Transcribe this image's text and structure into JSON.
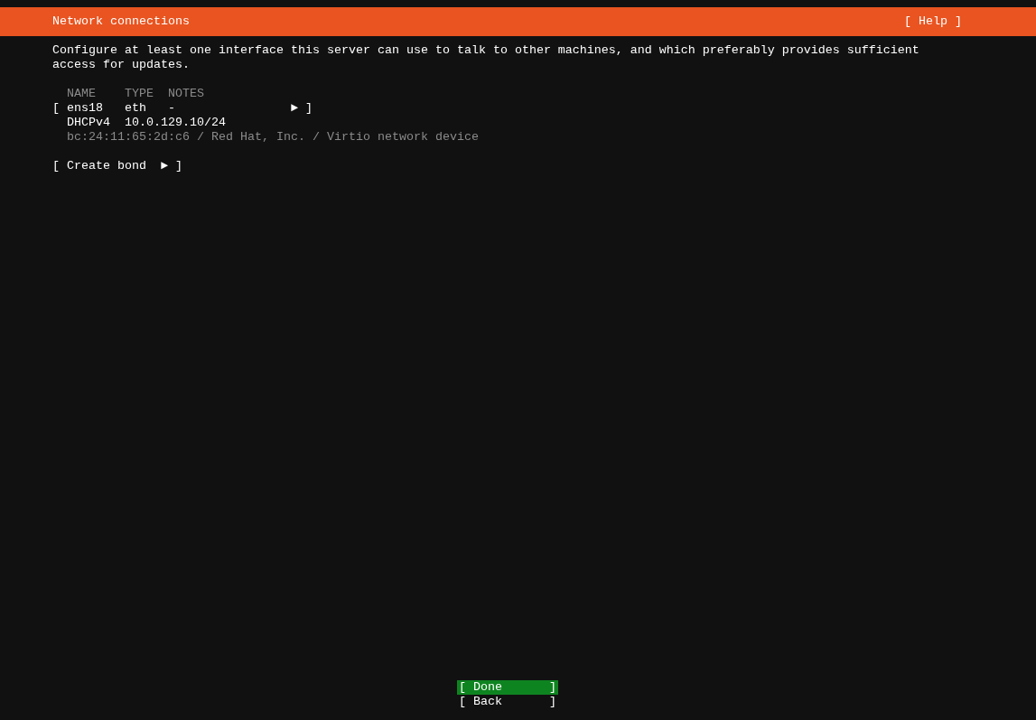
{
  "header": {
    "title": "Network connections",
    "help": "[ Help ]"
  },
  "description": "Configure at least one interface this server can use to talk to other machines, and which preferably provides sufficient access for updates.",
  "table": {
    "columns": [
      "NAME",
      "TYPE",
      "NOTES"
    ],
    "interfaces": [
      {
        "open": "[",
        "name": "ens18",
        "type": "eth",
        "notes": "-",
        "arrow": "►",
        "close": "]",
        "addresses": [
          {
            "method": "DHCPv4",
            "address": "10.0.129.10/24"
          }
        ],
        "detail": "bc:24:11:65:2d:c6 / Red Hat, Inc. / Virtio network device"
      }
    ]
  },
  "create_bond": {
    "open": "[",
    "label": "Create bond",
    "arrow": "►",
    "close": "]"
  },
  "buttons": [
    {
      "open": "[",
      "label": "Done",
      "close": "]",
      "selected": true
    },
    {
      "open": "[",
      "label": "Back",
      "close": "]",
      "selected": false
    }
  ]
}
